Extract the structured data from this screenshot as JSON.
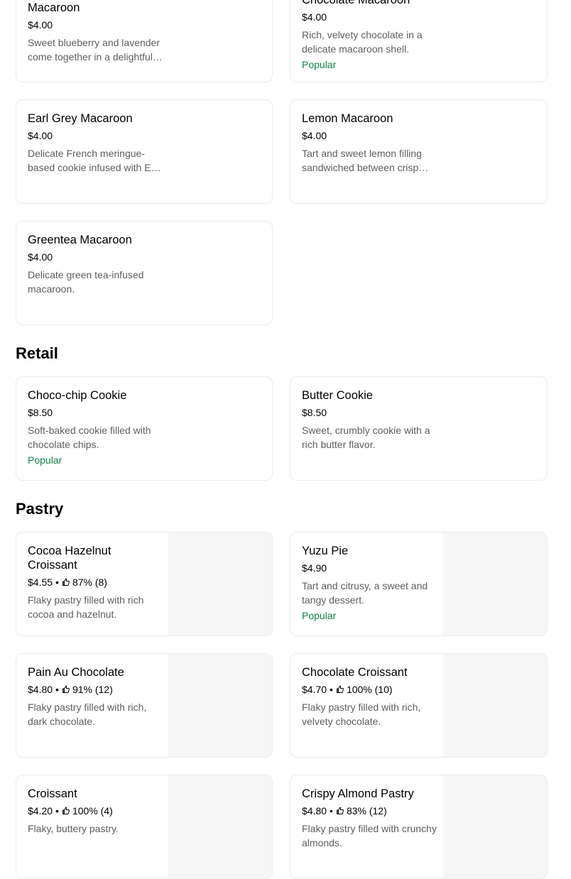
{
  "macarons": {
    "items": [
      {
        "title": "Blueberry Lavender Macaroon",
        "price": "$4.00",
        "desc": "Sweet blueberry and lavender come together in a delightful macaroon."
      },
      {
        "title": "Chocolate Macaroon",
        "price": "$4.00",
        "desc": "Rich, velvety chocolate in a delicate macaroon shell.",
        "badge": "Popular"
      },
      {
        "title": "Earl Grey Macaroon",
        "price": "$4.00",
        "desc": "Delicate French meringue-based cookie infused with Earl Grey tea."
      },
      {
        "title": "Lemon Macaroon",
        "price": "$4.00",
        "desc": "Tart and sweet lemon filling sandwiched between crisp shells."
      },
      {
        "title": "Greentea Macaroon",
        "price": "$4.00",
        "desc": "Delicate green tea-infused macaroon."
      }
    ]
  },
  "retail": {
    "heading": "Retail",
    "items": [
      {
        "title": "Choco-chip Cookie",
        "price": "$8.50",
        "desc": "Soft-baked cookie filled with chocolate chips.",
        "badge": "Popular"
      },
      {
        "title": "Butter Cookie",
        "price": "$8.50",
        "desc": "Sweet, crumbly cookie with a rich butter flavor."
      }
    ]
  },
  "pastry": {
    "heading": "Pastry",
    "items": [
      {
        "title": "Cocoa Hazelnut Croissant",
        "price": "$4.55",
        "rating": "87% (8)",
        "desc": "Flaky pastry filled with rich cocoa and hazelnut."
      },
      {
        "title": "Yuzu Pie",
        "price": "$4.90",
        "desc": "Tart and citrusy, a sweet and tangy dessert.",
        "badge": "Popular"
      },
      {
        "title": "Pain Au Chocolate",
        "price": "$4.80",
        "rating": "91% (12)",
        "desc": "Flaky pastry filled with rich, dark chocolate."
      },
      {
        "title": "Chocolate Croissant",
        "price": "$4.70",
        "rating": "100% (10)",
        "desc": "Flaky pastry filled with rich, velvety chocolate."
      },
      {
        "title": "Croissant",
        "price": "$4.20",
        "rating": "100% (4)",
        "desc": "Flaky, buttery pastry."
      },
      {
        "title": "Crispy Almond Pastry",
        "price": "$4.80",
        "rating": "83% (12)",
        "desc": "Flaky pastry filled with crunchy almonds."
      }
    ]
  },
  "meta_separator": "•",
  "colors": {
    "popular": "#0e8345",
    "description": "#5e5e5e",
    "border": "#ececec",
    "image_placeholder": "#f6f6f6"
  },
  "icons": {
    "rating": "thumbs-up-icon"
  }
}
